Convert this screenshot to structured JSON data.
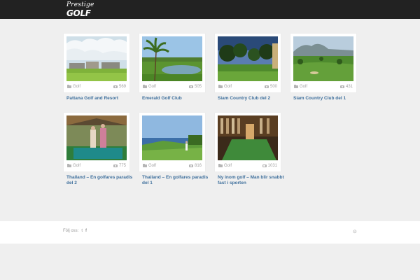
{
  "header": {
    "logo_line1": "Prestige",
    "logo_line2": "GOLF",
    "colors": {
      "bar": "#222222",
      "logo": "#ffffff"
    }
  },
  "gallery": {
    "items": [
      {
        "title": "Pattana Golf and Resort",
        "category": "Golf",
        "count": "569",
        "scene": "resort"
      },
      {
        "title": "Emerald Golf Club",
        "category": "Golf",
        "count": "505",
        "scene": "palm-lake"
      },
      {
        "title": "Siam Country Club del 2",
        "category": "Golf",
        "count": "500",
        "scene": "trees"
      },
      {
        "title": "Siam Country Club del 1",
        "category": "Golf",
        "count": "431",
        "scene": "mountain"
      },
      {
        "title": "Thailand – En golfares paradis del 2",
        "category": "Golf",
        "count": "775",
        "scene": "putting"
      },
      {
        "title": "Thailand – En golfares paradis del 1",
        "category": "Golf",
        "count": "816",
        "scene": "cliff"
      },
      {
        "title": "Ny inom golf – Man blir snabbt fast i sporten",
        "category": "Golf",
        "count": "1031",
        "scene": "indoor"
      }
    ],
    "colors": {
      "title": "#3e6f9c",
      "meta": "#a0a0a0"
    }
  },
  "footer": {
    "follow_label": "Följ oss:",
    "twitter_icon": "t",
    "facebook_icon": "f",
    "top_icon": "⊙"
  }
}
